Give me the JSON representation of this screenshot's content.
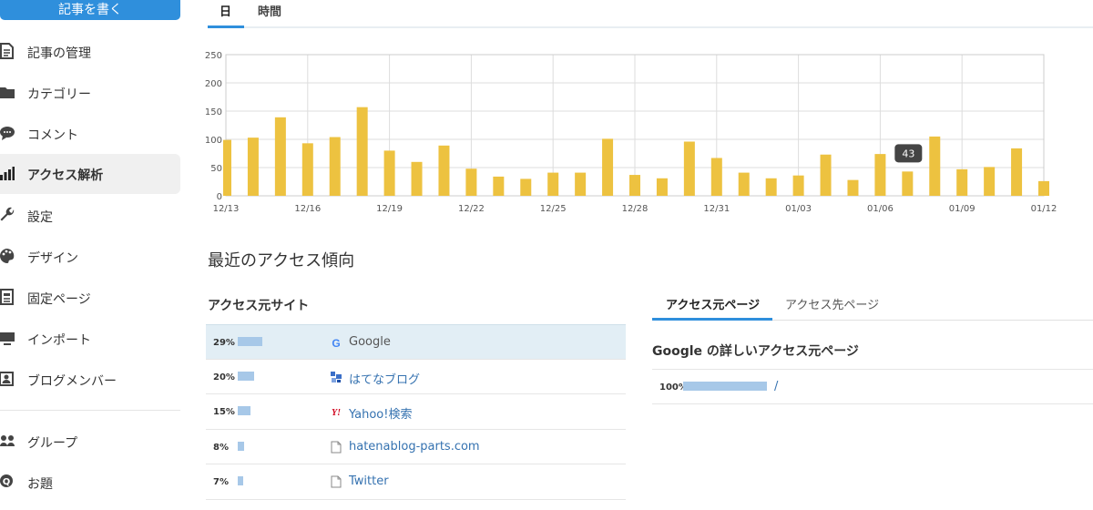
{
  "sidebar": {
    "write_button": "記事を書く",
    "items": [
      {
        "label": "記事の管理",
        "icon": "document-icon"
      },
      {
        "label": "カテゴリー",
        "icon": "folder-icon"
      },
      {
        "label": "コメント",
        "icon": "comment-icon"
      },
      {
        "label": "アクセス解析",
        "icon": "bar-chart-icon",
        "active": true
      },
      {
        "label": "設定",
        "icon": "wrench-icon"
      },
      {
        "label": "デザイン",
        "icon": "palette-icon"
      },
      {
        "label": "固定ページ",
        "icon": "page-icon"
      },
      {
        "label": "インポート",
        "icon": "import-icon"
      },
      {
        "label": "ブログメンバー",
        "icon": "member-icon"
      }
    ],
    "items2": [
      {
        "label": "グループ",
        "icon": "group-icon"
      },
      {
        "label": "お題",
        "icon": "topic-icon"
      }
    ]
  },
  "period_tabs": {
    "day": "日",
    "hour": "時間",
    "active": "day"
  },
  "chart_data": {
    "type": "bar",
    "x": [
      "12/13",
      "12/14",
      "12/15",
      "12/16",
      "12/17",
      "12/18",
      "12/19",
      "12/20",
      "12/21",
      "12/22",
      "12/23",
      "12/24",
      "12/25",
      "12/26",
      "12/27",
      "12/28",
      "12/29",
      "12/30",
      "12/31",
      "01/01",
      "01/02",
      "01/03",
      "01/04",
      "01/05",
      "01/06",
      "01/07",
      "01/08",
      "01/09",
      "01/10",
      "01/11",
      "01/12"
    ],
    "values": [
      99,
      103,
      139,
      93,
      104,
      157,
      80,
      60,
      89,
      48,
      34,
      30,
      41,
      41,
      101,
      37,
      31,
      96,
      67,
      41,
      31,
      36,
      73,
      28,
      74,
      43,
      105,
      47,
      51,
      84,
      26
    ],
    "ylim": [
      0,
      250
    ],
    "yticks": [
      0,
      50,
      100,
      150,
      200,
      250
    ],
    "xtick_labels": [
      "12/13",
      "12/16",
      "12/19",
      "12/22",
      "12/25",
      "12/28",
      "12/31",
      "01/03",
      "01/06",
      "01/09",
      "01/12"
    ],
    "bar_color": "#edc240",
    "tooltip": {
      "x": "01/07",
      "value": "43"
    }
  },
  "recent": {
    "title": "最近のアクセス傾向",
    "referrer_title": "アクセス元サイト",
    "referrers": [
      {
        "percent": "29%",
        "fraction": 0.29,
        "name": "Google",
        "icon": "google-icon",
        "selected": true
      },
      {
        "percent": "20%",
        "fraction": 0.2,
        "name": "はてなブログ",
        "icon": "hatena-icon"
      },
      {
        "percent": "15%",
        "fraction": 0.15,
        "name": "Yahoo!検索",
        "icon": "yahoo-icon"
      },
      {
        "percent": "8%",
        "fraction": 0.08,
        "name": "hatenablog-parts.com",
        "icon": "page-icon"
      },
      {
        "percent": "7%",
        "fraction": 0.07,
        "name": "Twitter",
        "icon": "page-icon"
      }
    ]
  },
  "detail": {
    "tabs": [
      {
        "label": "アクセス元ページ",
        "active": true
      },
      {
        "label": "アクセス先ページ"
      }
    ],
    "title": "Google の詳しいアクセス元ページ",
    "rows": [
      {
        "percent": "100%",
        "fraction": 1.0,
        "path": "/"
      }
    ]
  }
}
